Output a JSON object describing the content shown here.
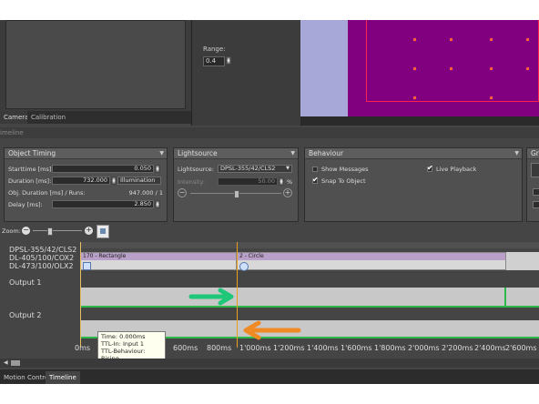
{
  "top": {
    "tabs": [
      {
        "label": "Camera"
      },
      {
        "label": "Calibration"
      }
    ],
    "range": {
      "label": "Range:",
      "value": "0.4"
    }
  },
  "timeline_header": "imeline",
  "object_timing": {
    "title": "Object Timing",
    "starttime_label": "Starttime [ms]:",
    "starttime_value": "0.050",
    "duration_label": "Duration [ms]:",
    "duration_value": "732.000",
    "duration_mode": "Illumination",
    "obj_duration_label": "Obj. Duration [ms] / Runs:",
    "obj_duration_value": "947.000 / 1",
    "delay_label": "Delay [ms]:",
    "delay_value": "2.850"
  },
  "lightsource": {
    "title": "Lightsource",
    "source_label": "Lightsource:",
    "source_value": "DPSL-355/42/CLS2",
    "intensity_label": "Intensity:",
    "intensity_value": "50.00",
    "intensity_unit": "%",
    "slider_level_percent": 50
  },
  "behaviour": {
    "title": "Behaviour",
    "show_messages": "Show Messages",
    "live_playback": "Live Playback",
    "snap_to_object": "Snap To Object",
    "show_messages_checked": false,
    "live_playback_checked": true,
    "snap_to_object_checked": true
  },
  "grid_panel": {
    "title": "Gri"
  },
  "zoom": {
    "label": "Zoom:"
  },
  "tracks": {
    "lightsource_labels": [
      "DPSL-355/42/CLS2",
      "DL-405/100/COX2",
      "DL-473/100/OLX2"
    ],
    "segments": [
      {
        "title": "170 - Rectangle"
      },
      {
        "title": "2 - Circle"
      }
    ],
    "outputs": [
      "Output 1",
      "Output 2"
    ]
  },
  "axis_ticks": [
    "0ms",
    "600ms",
    "800ms",
    "1'000ms",
    "1'200ms",
    "1'400ms",
    "1'600ms",
    "1'800ms",
    "2'000ms",
    "2'200ms",
    "2'400ms",
    "2'600ms"
  ],
  "tooltip": {
    "time": "Time: 0.000ms",
    "ttl_in": "TTL-In: Input 1",
    "ttl_behaviour": "TTL-Behaviour: Rising"
  },
  "bottom_tabs": [
    {
      "label": "Motion Control"
    },
    {
      "label": "Timeline"
    }
  ],
  "colors": {
    "arrow_green": "#1ec878",
    "arrow_orange": "#f08a24",
    "playhead": "#e8a020",
    "segment_header": "#b8a0c8",
    "viewport_purple": "#800080"
  }
}
